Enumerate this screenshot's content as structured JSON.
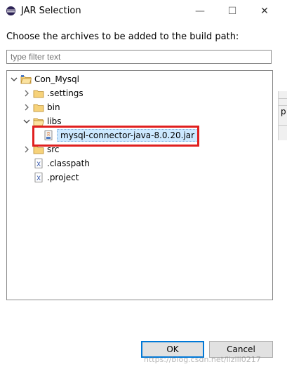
{
  "window": {
    "title": "JAR Selection",
    "icon": "eclipse-icon",
    "controls": {
      "minimize": "—",
      "maximize": "☐",
      "close": "✕"
    }
  },
  "instruction": "Choose the archives to be added to the build path:",
  "filter": {
    "placeholder": "type filter text",
    "value": ""
  },
  "tree": {
    "root": {
      "label": "Con_Mysql",
      "expanded": true,
      "icon": "project-folder-icon"
    },
    "items": [
      {
        "label": ".settings",
        "icon": "folder-icon",
        "expanded": false
      },
      {
        "label": "bin",
        "icon": "folder-icon",
        "expanded": false
      },
      {
        "label": "libs",
        "icon": "folder-open-icon",
        "expanded": true
      },
      {
        "label": "mysql-connector-java-8.0.20.jar",
        "icon": "jar-file-icon",
        "selected": true
      },
      {
        "label": "src",
        "icon": "folder-icon",
        "expanded": false
      },
      {
        "label": ".classpath",
        "icon": "xml-file-icon"
      },
      {
        "label": ".project",
        "icon": "xml-file-icon"
      }
    ]
  },
  "side_strip_letter": "p",
  "buttons": {
    "ok": "OK",
    "cancel": "Cancel"
  },
  "watermark": "https://blog.csdn.net/lizili0217",
  "colors": {
    "selection": "#cce8ff",
    "highlight_box": "#e02020",
    "ok_border": "#0078d7"
  }
}
